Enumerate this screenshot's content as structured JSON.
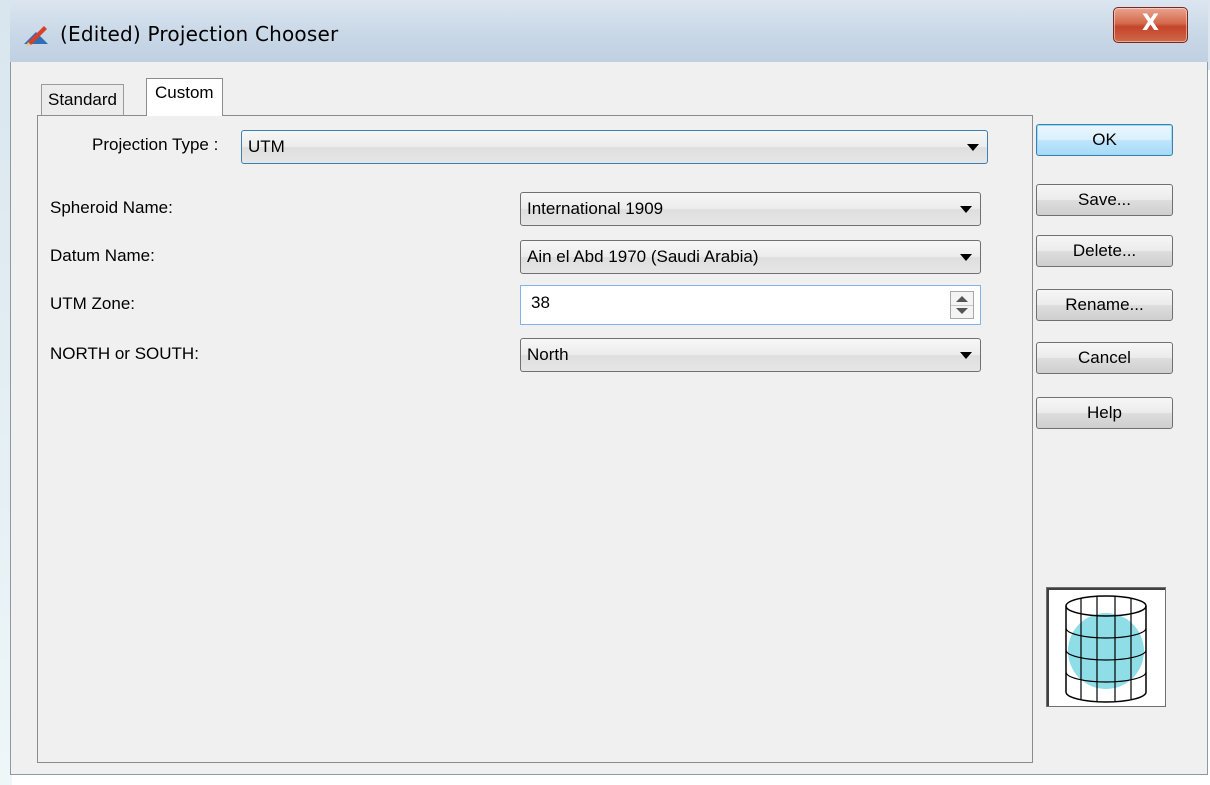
{
  "window": {
    "title": "(Edited) Projection Chooser",
    "close_label": "X"
  },
  "tabs": [
    {
      "label": "Standard",
      "active": false
    },
    {
      "label": "Custom",
      "active": true
    }
  ],
  "form": {
    "projection_type": {
      "label": "Projection Type :",
      "value": "UTM"
    },
    "spheroid_name": {
      "label": "Spheroid Name:",
      "value": "International 1909"
    },
    "datum_name": {
      "label": "Datum Name:",
      "value": "Ain el Abd 1970 (Saudi Arabia)"
    },
    "utm_zone": {
      "label": "UTM Zone:",
      "value": "38"
    },
    "north_south": {
      "label": "NORTH or SOUTH:",
      "value": "North"
    }
  },
  "buttons": {
    "ok": "OK",
    "save": "Save...",
    "delete": "Delete...",
    "rename": "Rename...",
    "cancel": "Cancel",
    "help": "Help"
  },
  "icons": {
    "app": "projection-pencil-icon",
    "preview": "cylindrical-projection-globe-icon"
  },
  "colors": {
    "ok_accent": "#3c7fb1",
    "close_red": "#c3442a",
    "globe_fill": "#8fdde6"
  }
}
